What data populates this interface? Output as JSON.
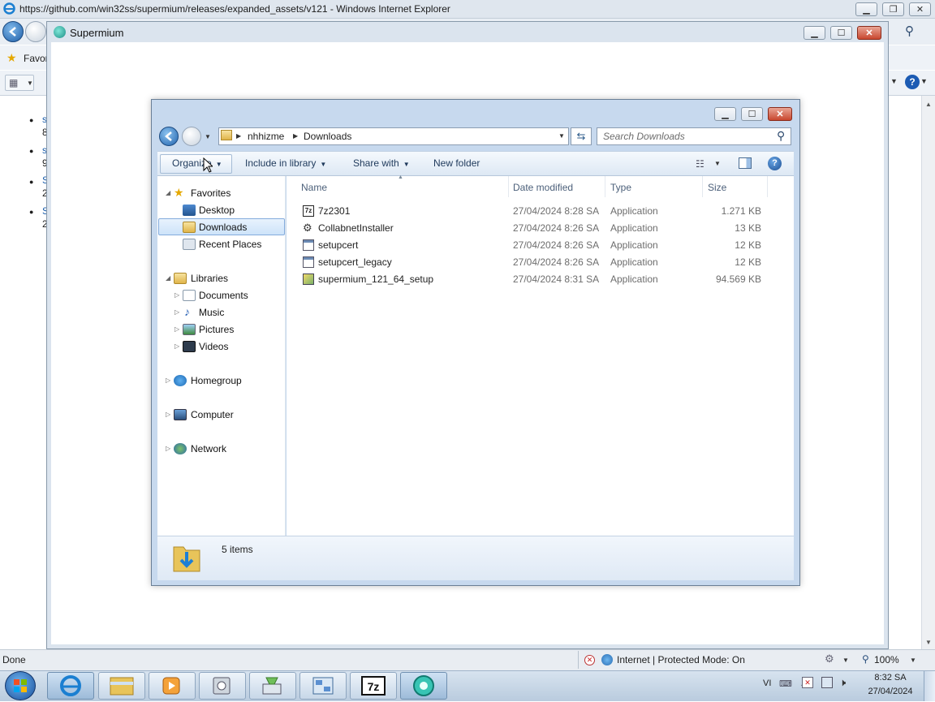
{
  "ie": {
    "title": "https://github.com/win32ss/supermium/releases/expanded_assets/v121 - Windows Internet Explorer",
    "favorites_fragment": "Favor",
    "status_done": "Done",
    "zone": "Internet | Protected Mode: On",
    "zoom": "100%",
    "left_fragments": [
      "s",
      "8",
      "s",
      "9",
      "S",
      "2",
      "S",
      "2"
    ]
  },
  "supermium": {
    "title": "Supermium"
  },
  "explorer": {
    "breadcrumb": [
      "nhhizme",
      "Downloads"
    ],
    "search_placeholder": "Search Downloads",
    "toolbar": {
      "organize": "Organize",
      "include": "Include in library",
      "share": "Share with",
      "new_folder": "New folder"
    },
    "nav": {
      "favorites": "Favorites",
      "favorites_items": [
        "Desktop",
        "Downloads",
        "Recent Places"
      ],
      "libraries": "Libraries",
      "libraries_items": [
        "Documents",
        "Music",
        "Pictures",
        "Videos"
      ],
      "homegroup": "Homegroup",
      "computer": "Computer",
      "network": "Network"
    },
    "columns": [
      "Name",
      "Date modified",
      "Type",
      "Size"
    ],
    "files": [
      {
        "name": "7z2301",
        "date": "27/04/2024 8:28 SA",
        "type": "Application",
        "size": "1.271 KB",
        "icon": "7z-icon"
      },
      {
        "name": "CollabnetInstaller",
        "date": "27/04/2024 8:26 SA",
        "type": "Application",
        "size": "13 KB",
        "icon": "installer-icon"
      },
      {
        "name": "setupcert",
        "date": "27/04/2024 8:26 SA",
        "type": "Application",
        "size": "12 KB",
        "icon": "exe-icon"
      },
      {
        "name": "setupcert_legacy",
        "date": "27/04/2024 8:26 SA",
        "type": "Application",
        "size": "12 KB",
        "icon": "exe-icon"
      },
      {
        "name": "supermium_121_64_setup",
        "date": "27/04/2024 8:31 SA",
        "type": "Application",
        "size": "94.569 KB",
        "icon": "setup-icon"
      }
    ],
    "item_count": "5 items"
  },
  "taskbar": {
    "lang": "VI",
    "time": "8:32 SA",
    "date": "27/04/2024"
  }
}
